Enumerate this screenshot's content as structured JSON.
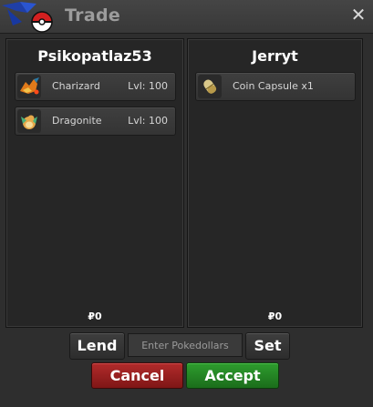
{
  "window": {
    "title": "Trade",
    "close_symbol": "✕"
  },
  "left_player": {
    "name": "Psikopatlaz53",
    "items": [
      {
        "name": "Charizard",
        "level": "Lvl: 100",
        "icon": "charizard-icon"
      },
      {
        "name": "Dragonite",
        "level": "Lvl: 100",
        "icon": "dragonite-icon"
      }
    ],
    "money": "₽0"
  },
  "right_player": {
    "name": "Jerryt",
    "items": [
      {
        "name": "Coin Capsule  x1",
        "icon": "coin-capsule-icon"
      }
    ],
    "money": "₽0"
  },
  "controls": {
    "lend_label": "Lend",
    "pokedollars_placeholder": "Enter Pokedollars",
    "set_label": "Set",
    "cancel_label": "Cancel",
    "accept_label": "Accept"
  },
  "colors": {
    "cancel": "#9c2020",
    "accept": "#238623",
    "title_text": "#9c9c9c"
  }
}
